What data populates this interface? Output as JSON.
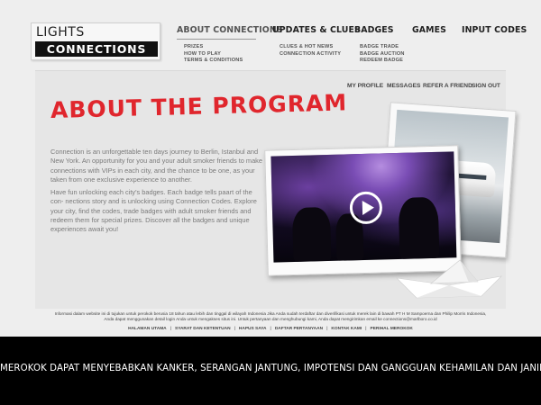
{
  "logo": {
    "top": "LIGHTS",
    "bottom": "CONNECTIONS"
  },
  "nav": [
    {
      "label": "ABOUT CONNECTIONS",
      "sub": [
        "PRIZES",
        "HOW TO PLAY",
        "TERMS & CONDITIONS"
      ]
    },
    {
      "label": "UPDATES & CLUES",
      "sub": [
        "CLUES & HOT NEWS",
        "CONNECTION ACTIVITY"
      ]
    },
    {
      "label": "BADGES",
      "sub": [
        "BADGE TRADE",
        "BADGE AUCTION",
        "REDEEM BADGE"
      ]
    },
    {
      "label": "GAMES",
      "sub": []
    },
    {
      "label": "INPUT CODES",
      "sub": []
    }
  ],
  "subnav": [
    "MY PROFILE",
    "MESSAGES",
    "REFER A FRIEND",
    "SIGN OUT"
  ],
  "content": {
    "title": "ABOUT THE PROGRAM",
    "paragraph1": "Connection is an unforgettable ten days journey to Berlin, Istanbul and New York. An opportunity for you and your adult smoker friends to make connections with VIPs in each city, and the chance to be one, as your taken from one exclusive experience to another.",
    "paragraph2": "Have fun unlocking each city's badges. Each badge tells paart of the con- nections story and is unlocking using Connection Codes. Explore your city, find the codes, trade badges with adult smoker friends and redeem them for special prizes. Discover all the badges and unique experiences await you!"
  },
  "footer": {
    "disclaimer_line1": "Informasi dalam website ini di tujukan untuk perokok berusia 18 tahun atau lebih dan tinggal di wilayah Indonesia Jika Anda sudah terdaftar dan diverifikasi untuk merek lain di bawah PT H M Sampoerna dan Philip Morris Indonesia,",
    "disclaimer_line2": "Anda dapat menggunakan detail login Anda untuk mengakses situs ini. Untuk pertanyaan dan menghubungi kami, Anda dapat mengirimkan email ke connections@marlboro.co.id",
    "links": [
      "HALAMAN UTAMA",
      "SYARAT DAN KETENTUAN",
      "HAPUS SAYA",
      "DAFTAR PERTANYAAN",
      "KONTAK KAMI",
      "PERIHAL MEROKOK"
    ],
    "separator": "|",
    "warning": "MEROKOK DAPAT MENYEBABKAN KANKER, SERANGAN JANTUNG, IMPOTENSI DAN GANGGUAN KEHAMILAN DAN JANIN"
  },
  "colors": {
    "title_red": "#e0262d",
    "warning_bg": "#000000",
    "panel_bg": "#e6e6e6"
  },
  "icons": {
    "video_play": "play-icon"
  }
}
